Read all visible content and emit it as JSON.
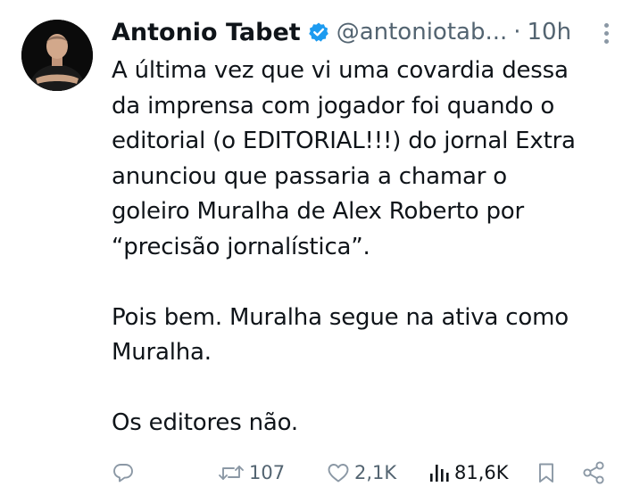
{
  "author": {
    "name": "Antonio Tabet",
    "handle": "@antoniotab...",
    "separator": "·",
    "time": "10h",
    "verified": true
  },
  "tweet": {
    "lines": [
      "A última vez que vi uma covardia dessa",
      "da imprensa com jogador foi quando o",
      "editorial (o EDITORIAL!!!) do jornal Extra",
      "anunciou que passaria a chamar o",
      "goleiro Muralha de Alex Roberto por",
      "“precisão jornalística”.",
      "",
      "Pois bem. Muralha segue na ativa como",
      "Muralha.",
      "",
      "Os editores não."
    ]
  },
  "actions": {
    "reply_count": "",
    "retweet_count": "107",
    "like_count": "2,1K",
    "views_count": "81,6K"
  },
  "icons": {
    "verified": "verified-badge-icon",
    "more": "more-options-icon",
    "reply": "reply-icon",
    "retweet": "retweet-icon",
    "like": "heart-icon",
    "views": "views-icon",
    "bookmark": "bookmark-icon",
    "share": "share-icon"
  },
  "colors": {
    "text": "#0f1419",
    "muted": "#536471",
    "verified_blue": "#1d9bf0",
    "icon_gray": "#8b98a5"
  }
}
